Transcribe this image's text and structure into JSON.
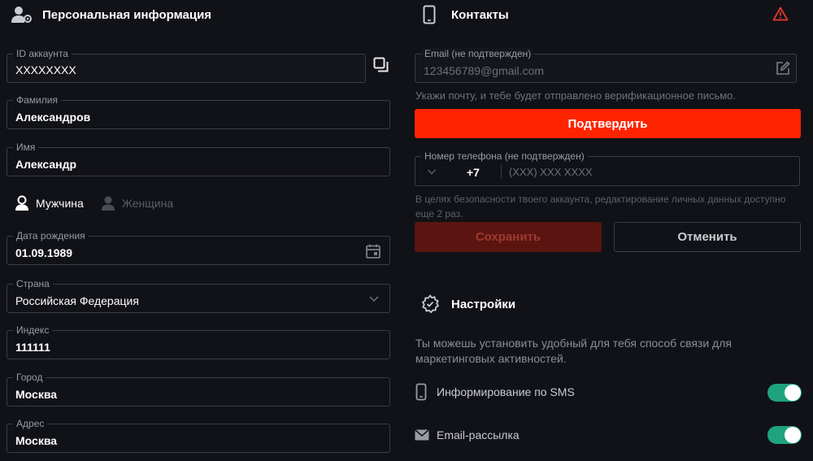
{
  "personal": {
    "title": "Персональная информация",
    "account_id": {
      "label": "ID аккаунта",
      "value": "XXXXXXXX"
    },
    "last_name": {
      "label": "Фамилия",
      "value": "Александров"
    },
    "first_name": {
      "label": "Имя",
      "value": "Александр"
    },
    "gender": {
      "male": "Мужчина",
      "female": "Женщина",
      "selected": "male"
    },
    "birth_date": {
      "label": "Дата рождения",
      "value": "01.09.1989"
    },
    "country": {
      "label": "Страна",
      "value": "Российская Федерация"
    },
    "postal_code": {
      "label": "Индекс",
      "value": "111111"
    },
    "city": {
      "label": "Город",
      "value": "Москва"
    },
    "address": {
      "label": "Адрес",
      "value": "Москва"
    }
  },
  "contacts": {
    "title": "Контакты",
    "email": {
      "label": "Email (не подтвержден)",
      "value": "123456789@gmail.com"
    },
    "email_hint": "Укажи почту, и тебе будет отправлено верификационное письмо.",
    "confirm_label": "Подтвердить",
    "phone": {
      "label": "Номер телефона (не подтвержден)",
      "code": "+7",
      "placeholder": "(XXX) XXX XXXX"
    },
    "security_hint": "В целях безопасности твоего аккаунта, редактирование личных данных доступно еще 2 раз.",
    "save_label": "Сохранить",
    "cancel_label": "Отменить"
  },
  "settings": {
    "title": "Настройки",
    "description": "Ты можешь установить удобный для тебя способ связи для маркетинговых активностей.",
    "items": [
      {
        "label": "Информирование по SMS",
        "icon": "phone-icon",
        "enabled": true
      },
      {
        "label": "Email-рассылка",
        "icon": "envelope-icon",
        "enabled": true
      }
    ]
  },
  "colors": {
    "background": "#111217",
    "accent": "#ff2400",
    "accent_disabled": "#5c1410",
    "toggle_on": "#1fa37f",
    "warning": "#e23a2e"
  }
}
